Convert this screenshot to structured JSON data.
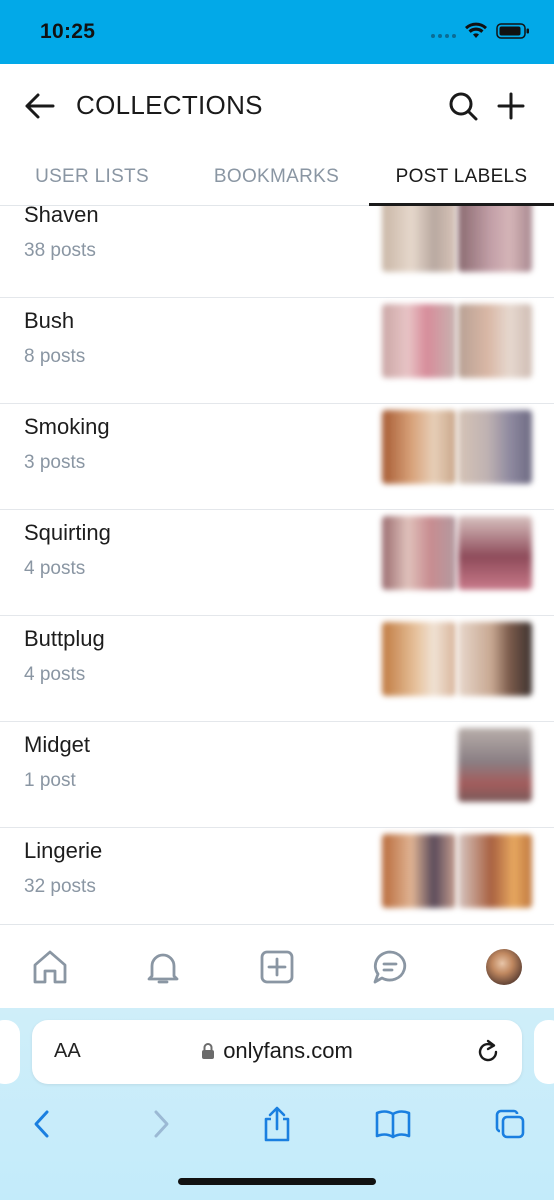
{
  "status_bar": {
    "time": "10:25",
    "background": "#02a9e8"
  },
  "header": {
    "title": "COLLECTIONS",
    "back_icon": "arrow-left-icon",
    "search_icon": "search-icon",
    "add_icon": "plus-icon"
  },
  "tabs": [
    {
      "label": "USER LISTS",
      "active": false
    },
    {
      "label": "BOOKMARKS",
      "active": false
    },
    {
      "label": "POST LABELS",
      "active": true
    }
  ],
  "labels": [
    {
      "title": "Shaven",
      "count": "38 posts"
    },
    {
      "title": "Bush",
      "count": "8 posts"
    },
    {
      "title": "Smoking",
      "count": "3 posts"
    },
    {
      "title": "Squirting",
      "count": "4 posts"
    },
    {
      "title": "Buttplug",
      "count": "4 posts"
    },
    {
      "title": "Midget",
      "count": "1 post"
    },
    {
      "title": "Lingerie",
      "count": "32 posts"
    }
  ],
  "bottom_nav": {
    "items": [
      "home-icon",
      "bell-icon",
      "add-post-icon",
      "messages-icon",
      "profile-avatar"
    ]
  },
  "browser": {
    "text_size_label": "AA",
    "url": "onlyfans.com",
    "tools": [
      "back-icon",
      "forward-icon",
      "share-icon",
      "bookmarks-icon",
      "tabs-icon"
    ],
    "accent": "#1a7fe0"
  }
}
